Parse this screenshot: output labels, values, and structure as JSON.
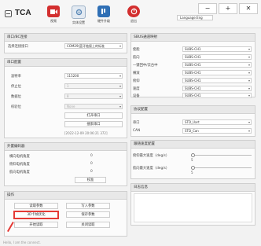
{
  "app": {
    "title": "TCA"
  },
  "toolbar": {
    "items": [
      {
        "label": "视频",
        "color": "#d32f2f"
      },
      {
        "label": "实体设置",
        "color": "#5c8ab8"
      },
      {
        "label": "硬件升级",
        "color": "#2f6fb5"
      },
      {
        "label": "退出",
        "color": "#d32f2f"
      }
    ],
    "language": "Language:Eng"
  },
  "window": {
    "minimize": "−",
    "maximize": "+",
    "close": "✕"
  },
  "pc_connect": {
    "header": "串口/BC连接",
    "label": "选择连接接口",
    "value": "COM29(蓝牙链接上的标准"
  },
  "serial_config": {
    "header": "串口配置",
    "rows": [
      {
        "label": "波特率",
        "value": "115200"
      },
      {
        "label": "停止位",
        "value": "1"
      },
      {
        "label": "数据位",
        "value": "8"
      },
      {
        "label": "校验位",
        "value": "None"
      }
    ],
    "open_label": "打开串口",
    "search_label": "搜索串口",
    "timestamp": "[2022-12-09 20:06:21 372]"
  },
  "motor_info": {
    "header": "外置编码器",
    "rows": [
      {
        "label": "横向电机角度",
        "value": "0"
      },
      {
        "label": "俯仰电机角度",
        "value": "0"
      },
      {
        "label": "航向电机角度",
        "value": "0"
      }
    ],
    "calib_label": "校准"
  },
  "operations": {
    "header": "操作",
    "buttons": [
      "读取参数",
      "写入参数",
      "3D卡帧优化",
      "保存参数",
      "开始读取",
      "关闭读取"
    ]
  },
  "sbus": {
    "header": "SBUS通道映射",
    "rows": [
      {
        "label": "使能",
        "value": "SUBS-CH1"
      },
      {
        "label": "航向",
        "value": "SUBS-CH1"
      },
      {
        "label": "一键回中/云台中",
        "value": "SUBS-CH1"
      },
      {
        "label": "横滚",
        "value": "SUBS-CH1"
      },
      {
        "label": "俯仰",
        "value": "SUBS-CH1"
      },
      {
        "label": "速度",
        "value": "SUBS-CH1"
      },
      {
        "label": "设备",
        "value": "SUBS-CH1"
      }
    ]
  },
  "protocol": {
    "header": "协议配置",
    "rows": [
      {
        "label": "串口",
        "value": "STD_Uart"
      },
      {
        "label": "CAN",
        "value": "STD_Can"
      }
    ]
  },
  "follow": {
    "header": "跟随速度配置",
    "rows": [
      {
        "label": "俯仰最大速度（deg/s）",
        "value": "5",
        "level": 0.03
      },
      {
        "label": "航向最大速度（deg/s）",
        "value": "5",
        "level": 0.03
      }
    ]
  },
  "log": {
    "header": "日志信息"
  },
  "status": {
    "text": "Hello, I am the connect."
  }
}
